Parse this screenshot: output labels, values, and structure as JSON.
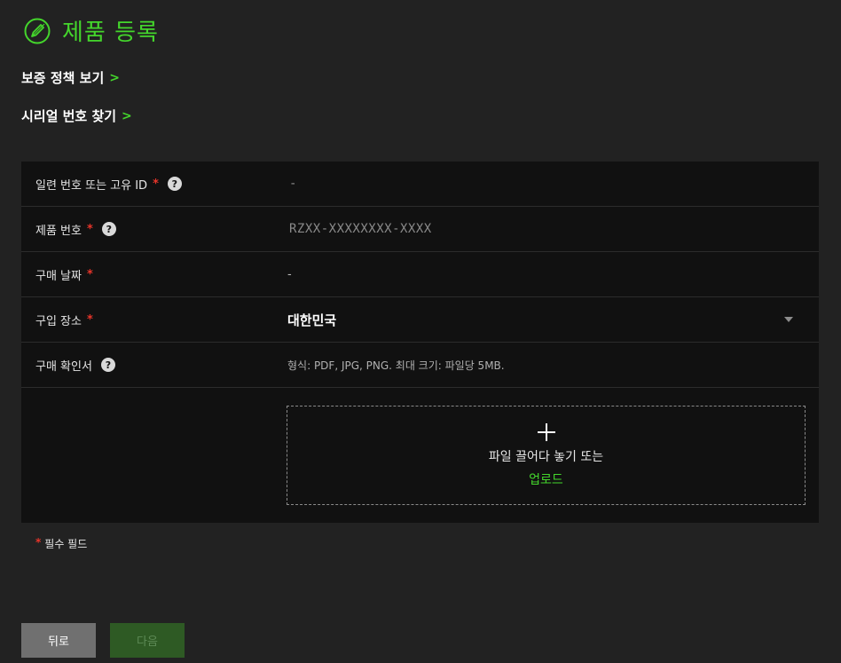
{
  "header": {
    "title": "제품 등록",
    "icon": "edit-circle-icon",
    "accent_color": "#44d62c"
  },
  "links": [
    {
      "label": "보증 정책 보기",
      "chevron": ">"
    },
    {
      "label": "시리얼 번호 찾기",
      "chevron": ">"
    }
  ],
  "form": {
    "required_mark": "*",
    "help_glyph": "?",
    "rows": {
      "serial": {
        "label": "일련 번호 또는 고유 ID",
        "placeholder": "-"
      },
      "product": {
        "label": "제품 번호",
        "placeholder": "RZXX-XXXXXXXX-XXXX"
      },
      "date": {
        "label": "구매 날짜",
        "value": "-"
      },
      "place": {
        "label": "구입 장소",
        "value": "대한민국"
      },
      "receipt": {
        "label": "구매 확인서",
        "hint": "형식: PDF, JPG, PNG. 최대 크기: 파일당 5MB."
      }
    },
    "dropzone": {
      "text": "파일 끌어다 놓기 또는",
      "upload_label": "업로드"
    }
  },
  "required_note": {
    "mark": "*",
    "text": "필수 필드"
  },
  "buttons": {
    "back": "뒤로",
    "next": "다음"
  },
  "colors": {
    "required": "#e8352a",
    "panel": "#111111",
    "background": "#222222"
  }
}
